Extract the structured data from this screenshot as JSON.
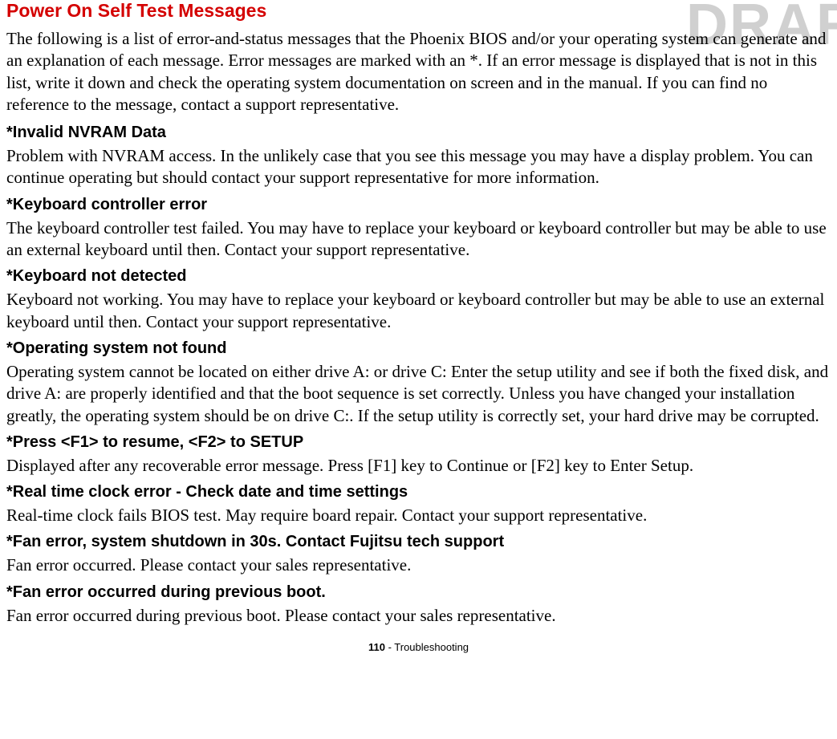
{
  "watermark": "DRAF",
  "section_title": "Power On Self Test Messages",
  "intro": "The following is a list of error-and-status messages that the Phoenix BIOS and/or your operating system can generate and an explanation of each message. Error messages are marked with an *. If an error message is displayed that is not in this list, write it down and check the operating system documentation on screen and in the manual. If you can find no reference to the message, contact a support representative.",
  "errors": [
    {
      "heading": "*Invalid NVRAM Data",
      "text": "Problem with NVRAM access. In the unlikely case that you see this message you may have a display problem. You can continue operating but should contact your support representative for more information."
    },
    {
      "heading": "*Keyboard controller error",
      "text": "The keyboard controller test failed. You may have to replace your keyboard or keyboard controller but may be able to use an external keyboard until then. Contact your support representative."
    },
    {
      "heading": "*Keyboard not detected",
      "text": "Keyboard not working. You may have to replace your keyboard or keyboard controller but may be able to use an external keyboard until then. Contact your support representative."
    },
    {
      "heading": "*Operating system not found",
      "text": "Operating system cannot be located on either drive A: or drive C: Enter the setup utility and see if both the fixed disk, and drive A: are properly identified and that the boot sequence is set correctly. Unless you have changed your installation greatly, the operating system should be on drive C:. If the setup utility is correctly set, your hard drive may be corrupted."
    },
    {
      "heading": "*Press <F1> to resume, <F2> to SETUP",
      "text": "Displayed after any recoverable error message. Press [F1] key to Continue or [F2] key to Enter Setup."
    },
    {
      "heading": "*Real time clock error - Check date and time settings",
      "text": "Real-time clock fails BIOS test. May require board repair. Contact your support representative."
    },
    {
      "heading": "*Fan error, system shutdown in 30s. Contact Fujitsu tech support",
      "text": "Fan error occurred. Please contact your sales representative."
    },
    {
      "heading": "*Fan error occurred during previous boot.",
      "text": "Fan error occurred during previous boot. Please contact your sales representative."
    }
  ],
  "footer": {
    "page": "110",
    "separator": " - ",
    "section": "Troubleshooting"
  }
}
